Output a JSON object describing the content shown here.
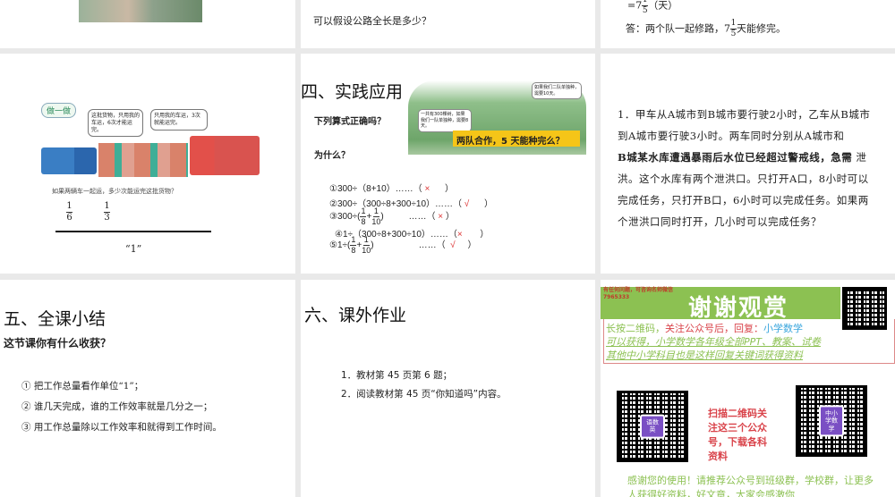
{
  "slide1": {
    "image": "illustration"
  },
  "slide2": {
    "question": "可以假设公路全长是多少？"
  },
  "slide3": {
    "eq_prefix": "=7",
    "eq_num": "1",
    "eq_den": "5",
    "eq_unit": "（天）",
    "answer_prefix": "答：两个队一起修路，",
    "answer_whole": "7",
    "answer_num": "1",
    "answer_den": "5",
    "answer_suffix": "天能修完。"
  },
  "slide4": {
    "badge": "做一做",
    "bubble1": "这批货物，只用我的车运，6次才能运完。",
    "bubble2": "只用我的车运，3次就能运完。",
    "question": "如果两辆车一起运，多少次能运完这批货物？",
    "frac1_num": "1",
    "frac1_den": "6",
    "frac2_num": "1",
    "frac2_den": "3",
    "whole_label": "“1”"
  },
  "slide5": {
    "title": "四、实践应用",
    "prompt1": "下列算式正确吗？",
    "prompt2": "为什么？",
    "bubble1": "一共有300棵树，如果我们一队单独种，需要8天。",
    "bubble2": "如果我们二队单独种，需要10天。",
    "banner": "两队合作，5 天能种完么？",
    "equations": [
      {
        "text": "①300÷（8+10）……（",
        "mark": "×",
        "end": "）"
      },
      {
        "text": "②300÷（300÷8+300÷10）……（",
        "mark": "√",
        "end": "）"
      },
      {
        "text": "③300÷",
        "f1": "1",
        "d1": "8",
        "f2": "1",
        "d2": "10",
        "dots": "……（",
        "mark": "×",
        "end": "）"
      },
      {
        "text": "④1÷（300÷8+300÷10）……（",
        "mark": "×",
        "end": "）"
      },
      {
        "text": "⑤1÷",
        "f1": "1",
        "d1": "8",
        "f2": "1",
        "d2": "10",
        "dots": "……（",
        "mark": "√",
        "end": "）"
      }
    ]
  },
  "slide6": {
    "problem": "1．甲车从A城市到B城市要行驶2小时，乙车从B城市到A城市要行驶3小时。两车同时分别从A城市和",
    "overlap": "B城某水库遭遇暴雨后水位已经超过警戒线，急需",
    "rest": "泄洪。这个水库有两个泄洪口。只打开A口，8小时可以完成任务，只打开B口，6小时可以完成任务。如果两个泄洪口同时打开，几小时可以完成任务？"
  },
  "slide7": {
    "title": "五、全课小结",
    "subtitle": "这节课你有什么收获？",
    "points": [
      "① 把工作总量看作单位“1”；",
      "② 谁几天完成，谁的工作效率就是几分之一；",
      "③ 用工作总量除以工作效率和就得到工作时间。"
    ]
  },
  "slide8": {
    "title": "六、课外作业",
    "items": [
      "1．教材第 45 页第 6 题；",
      "2．阅读教材第 45 页“你知道吗”内容。"
    ]
  },
  "slide9": {
    "contact": "有任何问题，可咨询名师微信7965333",
    "thanks": "谢谢观赏",
    "line1a": "长按二维码，",
    "line1b": "关注公众号后，回复：",
    "line1c": "小学数学",
    "line2": "可以获得，小学数学各年级全部PPT、教案、试卷",
    "line3": "其他中小学科目也是这样回复关键词获得资料",
    "scan": "扫描二维码关注这三个公众号，下载各科资料",
    "qr1_label": "语数英",
    "qr2_label": "中小学数学",
    "footer": "感谢您的使用！请推荐公众号到班级群，学校群，让更多人获得好资料，好文章，大家会感激你",
    "colors": {
      "green": "#8cc152",
      "red": "#d9434a",
      "blue": "#3aa6dd"
    }
  }
}
